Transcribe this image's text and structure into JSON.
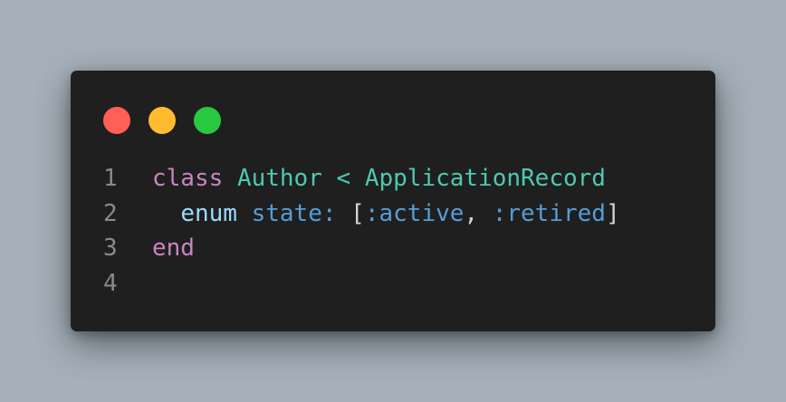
{
  "window": {
    "controls": [
      {
        "name": "close",
        "color": "#ff5f57"
      },
      {
        "name": "minimize",
        "color": "#febc2e"
      },
      {
        "name": "maximize",
        "color": "#28c840"
      }
    ]
  },
  "colors": {
    "keyword": "#c586c0",
    "class_name": "#4ec9b0",
    "operator": "#4ec9b0",
    "identifier": "#9cdcfe",
    "symbol": "#569cd6",
    "punctuation": "#d4d4d4",
    "line_number": "#8a8a8a"
  },
  "code": {
    "lines": [
      {
        "number": "1",
        "tokens": [
          {
            "text": "class",
            "type": "keyword"
          },
          {
            "text": " ",
            "type": "punctuation"
          },
          {
            "text": "Author",
            "type": "class_name"
          },
          {
            "text": " ",
            "type": "punctuation"
          },
          {
            "text": "<",
            "type": "operator"
          },
          {
            "text": " ",
            "type": "punctuation"
          },
          {
            "text": "ApplicationRecord",
            "type": "class_name"
          }
        ]
      },
      {
        "number": "2",
        "tokens": [
          {
            "text": "  ",
            "type": "punctuation"
          },
          {
            "text": "enum",
            "type": "identifier"
          },
          {
            "text": " ",
            "type": "punctuation"
          },
          {
            "text": "state:",
            "type": "symbol"
          },
          {
            "text": " ",
            "type": "punctuation"
          },
          {
            "text": "[",
            "type": "punctuation"
          },
          {
            "text": ":active",
            "type": "symbol"
          },
          {
            "text": ",",
            "type": "punctuation"
          },
          {
            "text": " ",
            "type": "punctuation"
          },
          {
            "text": ":retired",
            "type": "symbol"
          },
          {
            "text": "]",
            "type": "punctuation"
          }
        ]
      },
      {
        "number": "3",
        "tokens": [
          {
            "text": "end",
            "type": "keyword"
          }
        ]
      },
      {
        "number": "4",
        "tokens": []
      }
    ]
  }
}
